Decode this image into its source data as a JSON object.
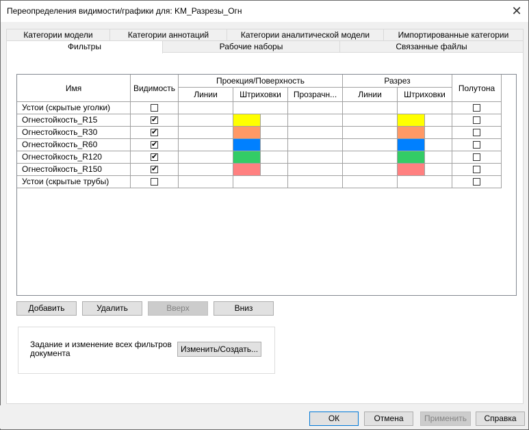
{
  "window": {
    "title": "Переопределения видимости/графики для: KM_Разрезы_Огн",
    "close_glyph": "✕"
  },
  "tabs_top": [
    {
      "label": "Категории модели"
    },
    {
      "label": "Категории аннотаций"
    },
    {
      "label": "Категории аналитической модели"
    },
    {
      "label": "Импортированные категории"
    }
  ],
  "tabs_bottom": [
    {
      "label": "Фильтры",
      "active": true
    },
    {
      "label": "Рабочие наборы"
    },
    {
      "label": "Связанные файлы"
    }
  ],
  "table": {
    "headers": {
      "name": "Имя",
      "visibility": "Видимость",
      "projection_group": "Проекция/Поверхность",
      "cut_group": "Разрез",
      "halftone": "Полутона",
      "proj_lines": "Линии",
      "proj_patterns": "Штриховки",
      "proj_transparency": "Прозрачн...",
      "cut_lines": "Линии",
      "cut_patterns": "Штриховки"
    },
    "rows": [
      {
        "name": "Устои (скрытые уголки)",
        "visible": false,
        "color": "",
        "halftone": false
      },
      {
        "name": "Огнестойкость_R15",
        "visible": true,
        "color": "#ffff00",
        "halftone": false
      },
      {
        "name": "Огнестойкость_R30",
        "visible": true,
        "color": "#ff9966",
        "halftone": false
      },
      {
        "name": "Огнестойкость_R60",
        "visible": true,
        "color": "#0080ff",
        "halftone": false
      },
      {
        "name": "Огнестойкость_R120",
        "visible": true,
        "color": "#33cc66",
        "halftone": false
      },
      {
        "name": "Огнестойкость_R150",
        "visible": true,
        "color": "#ff8080",
        "halftone": false
      },
      {
        "name": "Устои (скрытые трубы)",
        "visible": false,
        "color": "",
        "halftone": false
      }
    ]
  },
  "buttons": {
    "add": "Добавить",
    "delete": "Удалить",
    "up": "Вверх",
    "down": "Вниз",
    "edit_create": "Изменить/Создать...",
    "ok": "ОК",
    "cancel": "Отмена",
    "apply": "Применить",
    "help": "Справка"
  },
  "filters_group": {
    "description": "Задание и изменение всех фильтров документа"
  },
  "check_glyph": "✔"
}
